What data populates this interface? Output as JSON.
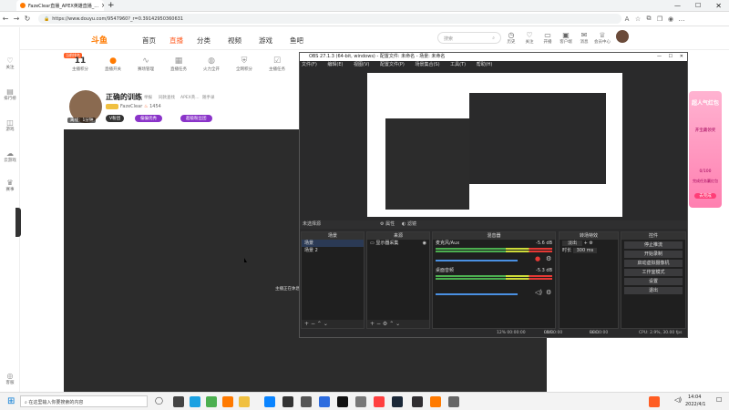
{
  "browser": {
    "tab_title": "FazeClear直播_APEX英雄直播_...",
    "url": "https://www.douyu.com/9547960?_r=0.39142950360631",
    "new_tab": "+",
    "close_tab": "×"
  },
  "sidebar": {
    "items": [
      {
        "label": "关注",
        "icon": "heart-icon"
      },
      {
        "label": "排行榜",
        "icon": "ranking-icon"
      },
      {
        "label": "游戏",
        "icon": "gamepad-icon"
      },
      {
        "label": "云游戏",
        "icon": "cloud-game-icon"
      },
      {
        "label": "赛事",
        "icon": "trophy-icon"
      },
      {
        "label": "客服",
        "icon": "service-icon"
      }
    ]
  },
  "site": {
    "logo": "斗鱼",
    "nav": [
      "首页",
      "直播",
      "分类",
      "视频",
      "游戏",
      "鱼吧"
    ],
    "search_placeholder": "搜索",
    "header_icons": [
      "历史",
      "关注",
      "开播",
      "客户端",
      "消息",
      "会员中心"
    ]
  },
  "stats": {
    "badge": "当前排名",
    "first_value": "11",
    "first_label": "主播积分",
    "items": [
      "直播开关",
      "赛场管理",
      "直播任务",
      "火力全开",
      "全网积分",
      "主播任务"
    ]
  },
  "streamer": {
    "name": "正确的训练",
    "tags": [
      "举报",
      "同款查找",
      "APEX英...",
      "随手录"
    ],
    "author": "FazeClear",
    "fans": "1454",
    "status": "离线：1分钟",
    "btn1": "V粉团",
    "btn2": "偏偏优秀",
    "btn3": "超级粉丝团"
  },
  "player": {
    "overlay_text": "主播正在休息"
  },
  "obs": {
    "title": "OBS 27.1.3 (64-bit, windows) - 配置文件: 未命名 - 场景: 未命名",
    "menu": [
      "文件(F)",
      "编辑(E)",
      "视图(V)",
      "配置文件(P)",
      "场景集合(S)",
      "工具(T)",
      "帮助(H)"
    ],
    "panel_bar": "未选择源",
    "panel_buttons": [
      "属性",
      "滤镜"
    ],
    "scenes_header": "场景",
    "scenes": [
      "场景",
      "场景 2"
    ],
    "sources_header": "来源",
    "sources": [
      "显示器采集"
    ],
    "mixer_header": "混音器",
    "mixer": [
      {
        "name": "麦克风/Aux",
        "db": "-5.6 dB"
      },
      {
        "name": "桌面音频",
        "db": "-5.3 dB"
      }
    ],
    "transitions_header": "转场特效",
    "transition_value": "淡出",
    "duration_label": "时长",
    "duration_value": "300 ms",
    "controls_header": "控件",
    "controls": [
      "停止推流",
      "开始录制",
      "启动虚拟摄像机",
      "工作室模式",
      "设置",
      "退出"
    ],
    "status": {
      "live": "LIVE:",
      "live_time": "00:00:00",
      "rec": "REC:",
      "rec_time": "00:00:00",
      "cpu": "CPU: 2.9%, 30.00 fps",
      "kbps": "12% 00:00:00"
    }
  },
  "ad": {
    "title": "超人气红包",
    "sub": "开宝藏领奖",
    "count": "0/100",
    "desc": "完成任务赢红包",
    "btn": "去完成"
  },
  "taskbar": {
    "search": "在这里输入你要搜索的内容",
    "time": "14:04",
    "date": "2022/4/1"
  }
}
